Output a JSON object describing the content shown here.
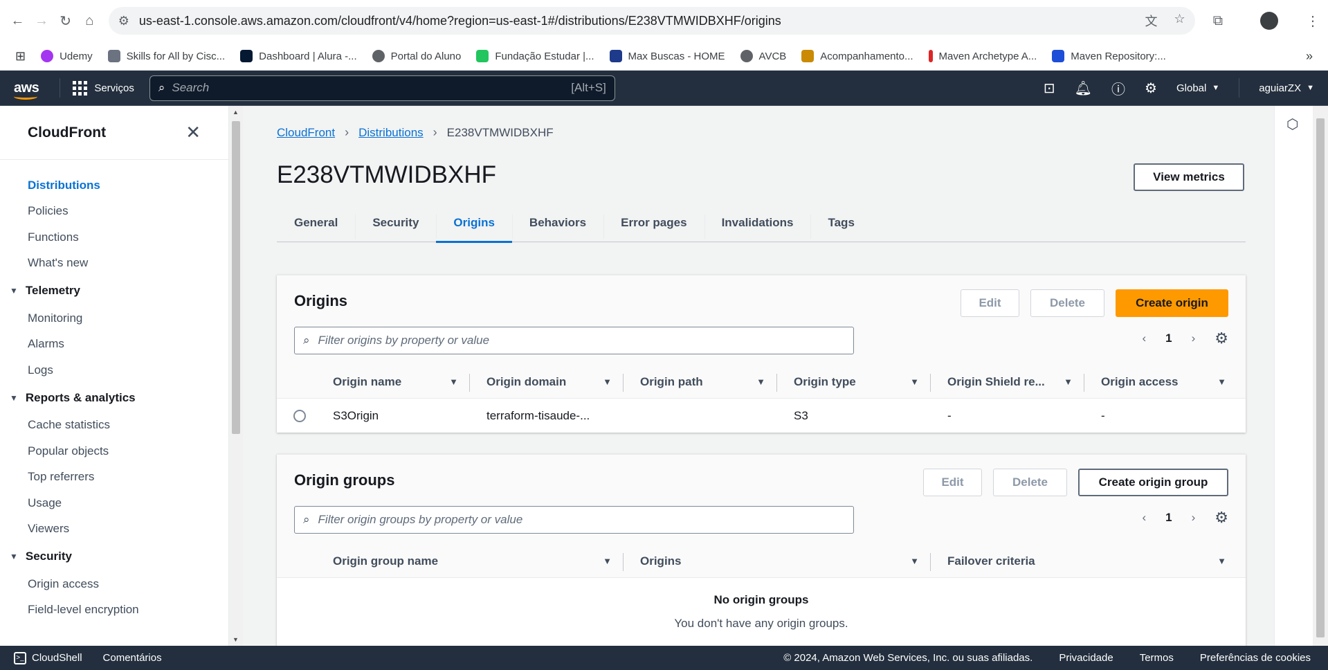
{
  "browser": {
    "url": "us-east-1.console.aws.amazon.com/cloudfront/v4/home?region=us-east-1#/distributions/E238VTMWIDBXHF/origins",
    "bookmarks": [
      {
        "label": "Udemy",
        "color": "#a435f0"
      },
      {
        "label": "Skills for All by Cisc...",
        "color": "#6b7280"
      },
      {
        "label": "Dashboard | Alura -...",
        "color": "#051933"
      },
      {
        "label": "Portal do Aluno",
        "color": "#5f6368"
      },
      {
        "label": "Fundação Estudar |...",
        "color": "#22c55e"
      },
      {
        "label": "Max Buscas - HOME",
        "color": "#1e3a8a"
      },
      {
        "label": "AVCB",
        "color": "#5f6368"
      },
      {
        "label": "Acompanhamento...",
        "color": "#ca8a04"
      },
      {
        "label": "Maven Archetype A...",
        "color": "#dc2626"
      },
      {
        "label": "Maven Repository:...",
        "color": "#1d4ed8"
      }
    ]
  },
  "topnav": {
    "logo": "aws",
    "services_label": "Serviços",
    "search_placeholder": "Search",
    "search_shortcut": "[Alt+S]",
    "region": "Global",
    "user": "aguiarZX"
  },
  "sidebar": {
    "title": "CloudFront",
    "items": [
      {
        "label": "Distributions",
        "active": true
      },
      {
        "label": "Policies"
      },
      {
        "label": "Functions"
      },
      {
        "label": "What's new"
      }
    ],
    "sections": [
      {
        "title": "Telemetry",
        "items": [
          "Monitoring",
          "Alarms",
          "Logs"
        ]
      },
      {
        "title": "Reports & analytics",
        "items": [
          "Cache statistics",
          "Popular objects",
          "Top referrers",
          "Usage",
          "Viewers"
        ]
      },
      {
        "title": "Security",
        "items": [
          "Origin access",
          "Field-level encryption"
        ]
      }
    ]
  },
  "breadcrumb": {
    "items": [
      "CloudFront",
      "Distributions"
    ],
    "current": "E238VTMWIDBXHF"
  },
  "page": {
    "title": "E238VTMWIDBXHF",
    "view_metrics": "View metrics"
  },
  "tabs": [
    "General",
    "Security",
    "Origins",
    "Behaviors",
    "Error pages",
    "Invalidations",
    "Tags"
  ],
  "active_tab": "Origins",
  "origins": {
    "title": "Origins",
    "edit": "Edit",
    "delete": "Delete",
    "create": "Create origin",
    "filter_placeholder": "Filter origins by property or value",
    "page": "1",
    "columns": [
      "Origin name",
      "Origin domain",
      "Origin path",
      "Origin type",
      "Origin Shield re...",
      "Origin access"
    ],
    "rows": [
      {
        "name": "S3Origin",
        "domain": "terraform-tisaude-...",
        "path": "",
        "type": "S3",
        "shield": "-",
        "access": "-"
      }
    ]
  },
  "origin_groups": {
    "title": "Origin groups",
    "edit": "Edit",
    "delete": "Delete",
    "create": "Create origin group",
    "filter_placeholder": "Filter origin groups by property or value",
    "page": "1",
    "columns": [
      "Origin group name",
      "Origins",
      "Failover criteria"
    ],
    "empty_title": "No origin groups",
    "empty_text": "You don't have any origin groups."
  },
  "footer": {
    "cloudshell": "CloudShell",
    "feedback": "Comentários",
    "copyright": "© 2024, Amazon Web Services, Inc. ou suas afiliadas.",
    "links": [
      "Privacidade",
      "Termos",
      "Preferências de cookies"
    ]
  }
}
